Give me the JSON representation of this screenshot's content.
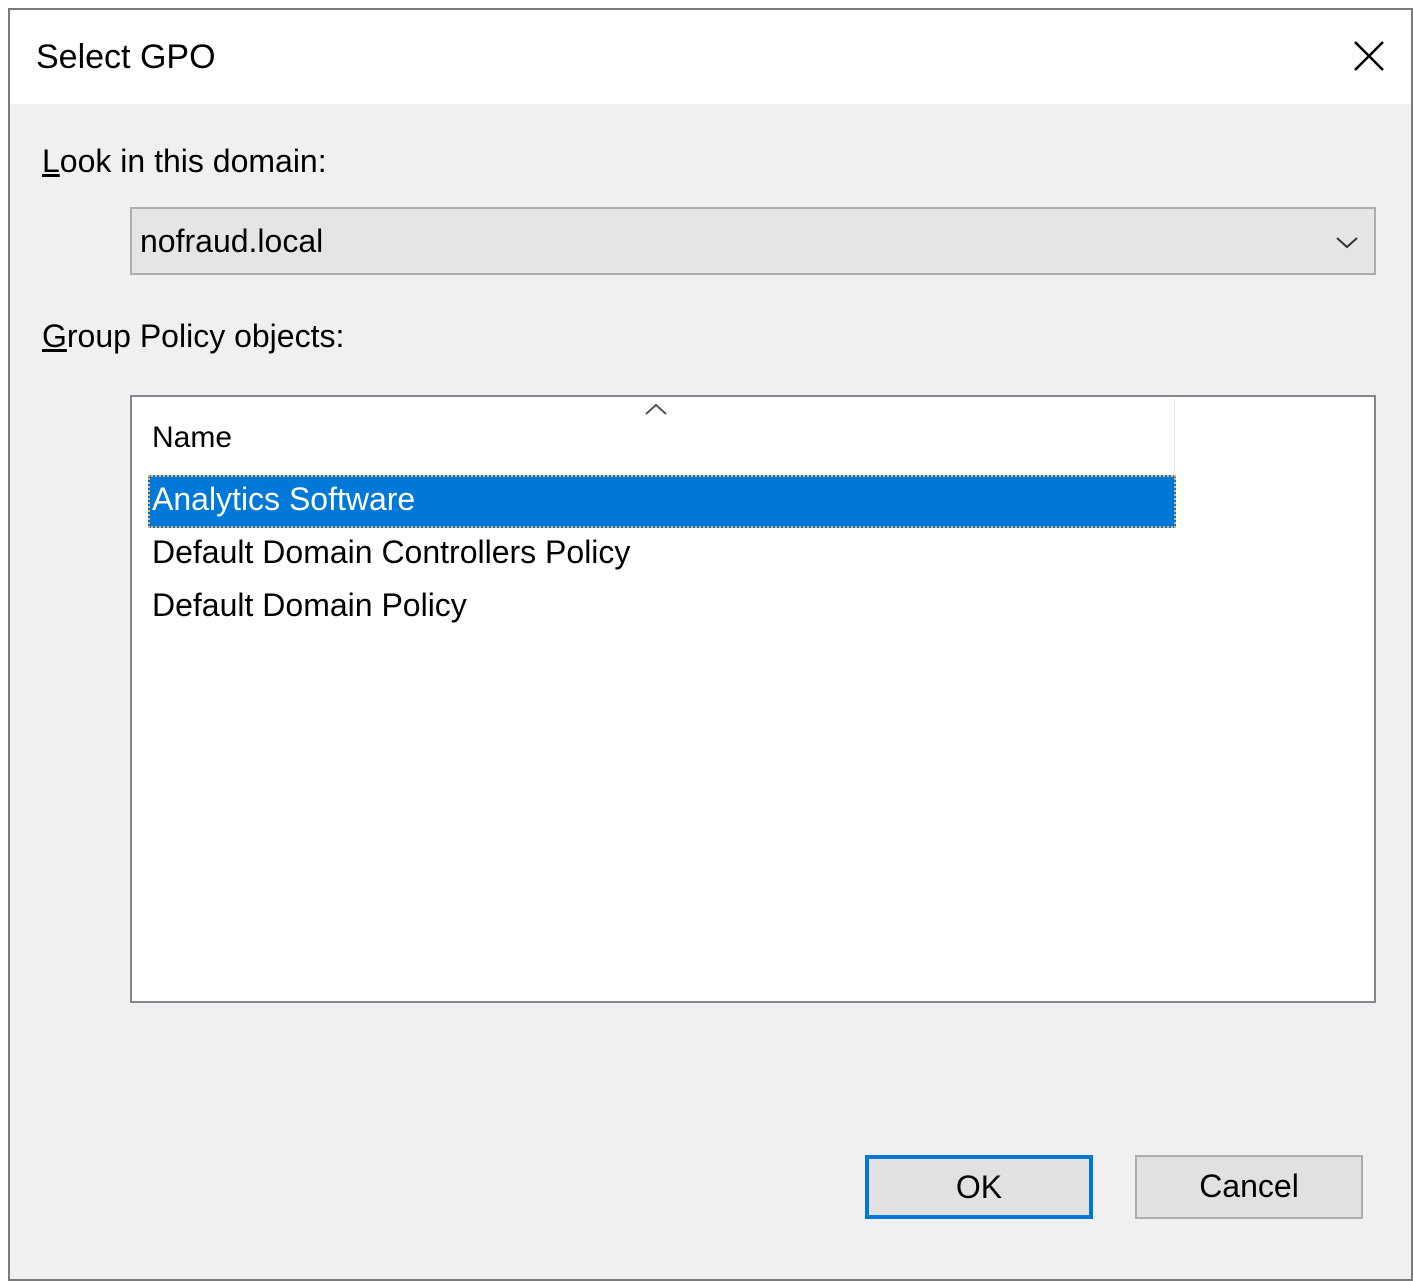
{
  "window": {
    "title": "Select GPO"
  },
  "domain_label": {
    "accel": "L",
    "rest": "ook in this domain:"
  },
  "domain_select": {
    "value": "nofraud.local"
  },
  "gpo_label": {
    "accel": "G",
    "rest": "roup Policy objects:"
  },
  "list": {
    "column_name": "Name",
    "sort_direction": "ascending",
    "items": [
      {
        "name": "Analytics Software",
        "selected": true
      },
      {
        "name": "Default Domain Controllers Policy",
        "selected": false
      },
      {
        "name": "Default Domain Policy",
        "selected": false
      }
    ]
  },
  "buttons": {
    "ok_label": "OK",
    "cancel_label": "Cancel"
  },
  "colors": {
    "accent": "#0078d7",
    "dialog_bg": "#f0f0f0",
    "titlebar_bg": "#ffffff",
    "focus_outline": "#f5b26b"
  },
  "icons": {
    "close": "close-icon",
    "dropdown": "chevron-down-icon",
    "sort": "sort-ascending-icon"
  }
}
